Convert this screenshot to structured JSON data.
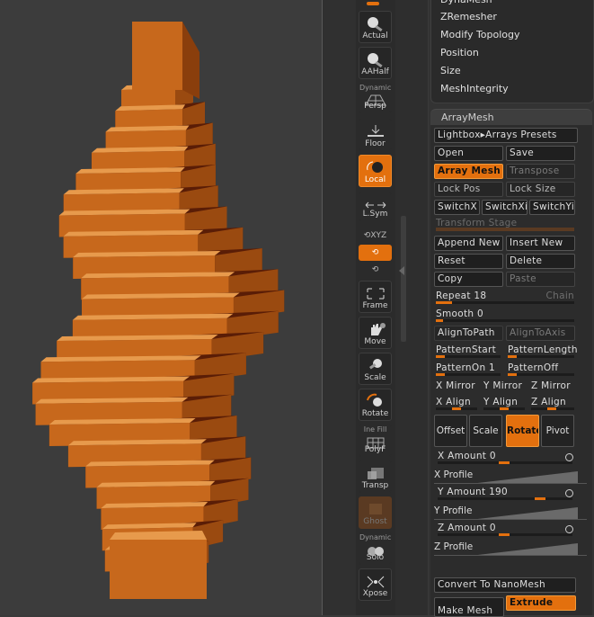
{
  "shelf": {
    "actual": "Actual",
    "aahalf": "AAHalf",
    "dynamic_persp": "Dynamic",
    "persp": "Persp",
    "floor": "Floor",
    "local": "Local",
    "lsym": "L.Sym",
    "xyz": "XYZ",
    "frame": "Frame",
    "move": "Move",
    "scale": "Scale",
    "rotate": "Rotate",
    "ine_fill": "Ine Fill",
    "polyf": "PolyF",
    "transp": "Transp",
    "ghost": "Ghost",
    "dynamic_solo": "Dynamic",
    "solo": "Solo",
    "xpose": "Xpose"
  },
  "top_menu": {
    "items": [
      "DynaMesh",
      "ZRemesher",
      "Modify Topology",
      "Position",
      "Size",
      "MeshIntegrity"
    ]
  },
  "arraymesh": {
    "title": "ArrayMesh",
    "lightbox": "Lightbox",
    "arrays_presets": "Arrays Presets",
    "open": "Open",
    "save": "Save",
    "array_mesh": "Array Mesh",
    "transpose": "Transpose",
    "lock_pos": "Lock Pos",
    "lock_size": "Lock Size",
    "switch_x": "SwitchX",
    "switch_xi": "SwitchXi",
    "switch_yi": "SwitchYi",
    "transform_stage": "Transform Stage",
    "append_new": "Append New",
    "insert_new": "Insert New",
    "reset": "Reset",
    "delete": "Delete",
    "copy": "Copy",
    "paste": "Paste",
    "repeat_label": "Repeat",
    "repeat_value": "18",
    "repeat_fraction": 0.12,
    "chain": "Chain",
    "smooth_label": "Smooth",
    "smooth_value": "0",
    "align_to_path": "AlignToPath",
    "align_to_axis": "AlignToAxis",
    "pattern_start": "PatternStart",
    "pattern_length": "PatternLength",
    "pattern_on": "PatternOn 1",
    "pattern_off": "PatternOff",
    "x_mirror": "X Mirror",
    "y_mirror": "Y Mirror",
    "z_mirror": "Z Mirror",
    "x_align": "X Align",
    "y_align": "Y Align",
    "z_align": "Z Align",
    "offset": "Offset",
    "scale": "Scale",
    "rotate": "Rotate",
    "pivot": "Pivot",
    "x_amount_label": "X Amount",
    "x_amount_value": "0",
    "x_profile": "X Profile",
    "y_amount_label": "Y Amount",
    "y_amount_value": "190",
    "y_amount_fraction": 0.78,
    "y_profile": "Y Profile",
    "z_amount_label": "Z Amount",
    "z_amount_value": "0",
    "z_profile": "Z Profile",
    "convert_nanomesh": "Convert To NanoMesh",
    "make_mesh": "Make Mesh",
    "extrude": "Extrude"
  },
  "colors": {
    "accent": "#e3700e",
    "panel_bg": "#2c2c2c",
    "brick": "#c96a1e"
  }
}
